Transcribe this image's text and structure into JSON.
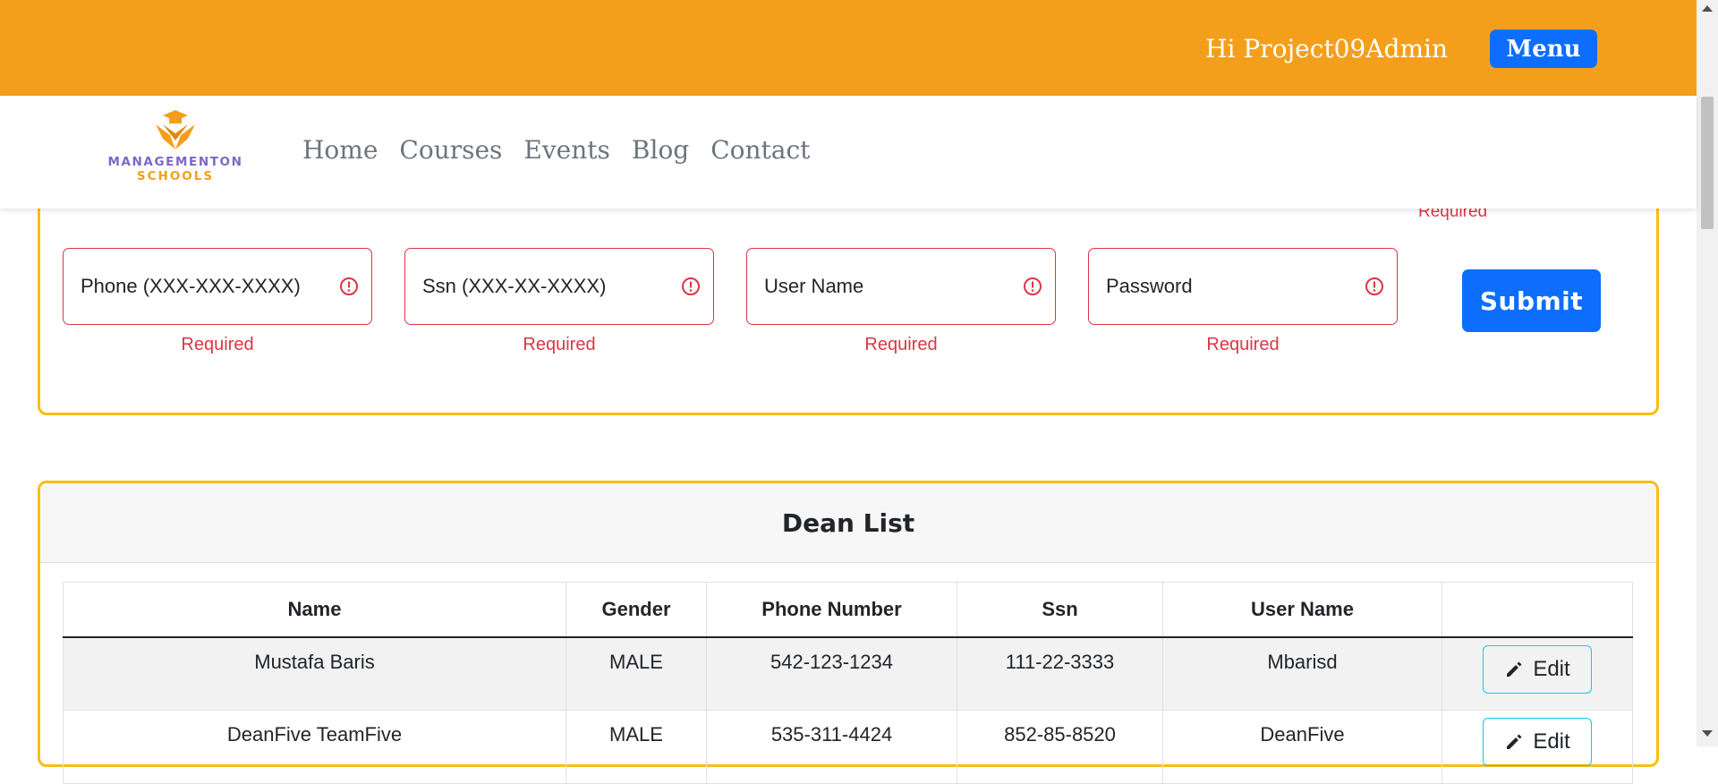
{
  "header": {
    "greeting": "Hi Project09Admin",
    "menu_label": "Menu"
  },
  "brand": {
    "line1": "MANAGEMENTON",
    "line2": "SCHOOLS"
  },
  "nav": {
    "items": [
      {
        "label": "Home"
      },
      {
        "label": "Courses"
      },
      {
        "label": "Events"
      },
      {
        "label": "Blog"
      },
      {
        "label": "Contact"
      }
    ]
  },
  "form": {
    "top_required": "Required",
    "fields": [
      {
        "placeholder": "Phone (XXX-XXX-XXXX)",
        "error": "Required"
      },
      {
        "placeholder": "Ssn (XXX-XX-XXXX)",
        "error": "Required"
      },
      {
        "placeholder": "User Name",
        "error": "Required"
      },
      {
        "placeholder": "Password",
        "error": "Required"
      }
    ],
    "submit_label": "Submit"
  },
  "dean_list": {
    "title": "Dean List",
    "columns": [
      "Name",
      "Gender",
      "Phone Number",
      "Ssn",
      "User Name",
      ""
    ],
    "rows": [
      {
        "name": "Mustafa Baris",
        "gender": "MALE",
        "phone": "542-123-1234",
        "ssn": "111-22-3333",
        "username": "Mbarisd",
        "action": "Edit"
      },
      {
        "name": "DeanFive TeamFive",
        "gender": "MALE",
        "phone": "535-311-4424",
        "ssn": "852-85-8520",
        "username": "DeanFive",
        "action": "Edit"
      }
    ]
  },
  "colors": {
    "header_bg": "#f49f1c",
    "primary": "#0d6efd",
    "card_border": "#fbbd14",
    "error": "#dc3545",
    "edit_border": "#0dcaf0"
  },
  "icons": {
    "error": "exclamation-circle-icon",
    "edit": "pencil-icon"
  }
}
